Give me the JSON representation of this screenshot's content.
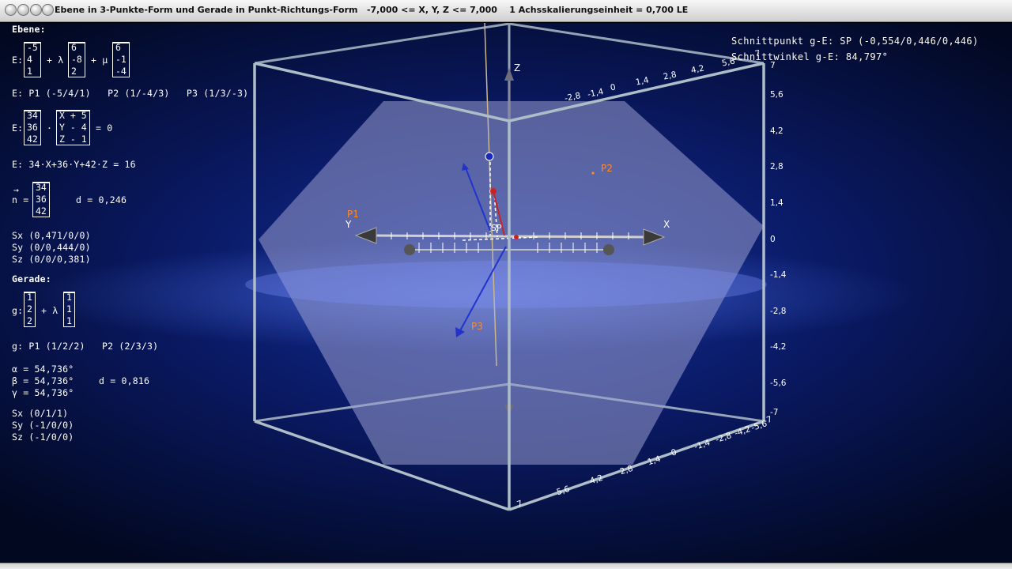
{
  "window": {
    "title": "Ebene in 3-Punkte-Form und Gerade in Punkt-Richtungs-Form   -7,000 <= X, Y, Z <= 7,000    1 Achsskalierungseinheit = 0,700 LE"
  },
  "colors": {
    "background": "#0a1a66",
    "plane": "#8a8fc0",
    "cube_edges": "#b8c8d0",
    "point_labels": "#ff8a2a",
    "line_g": "#b8a878",
    "normal_vector": "#1a2ab8",
    "text": "#ffffff"
  },
  "plane_panel": {
    "heading": "Ebene:",
    "three_point_form": {
      "prefix": "E:",
      "support": [
        "-5",
        "4",
        "1"
      ],
      "lambda": "+ λ",
      "dir1": [
        "6",
        "-8",
        "2"
      ],
      "mu": "+ μ",
      "dir2": [
        "6",
        "-1",
        "-4"
      ]
    },
    "points": "E: P1 (-5/4/1)   P2 (1/-4/3)   P3 (1/3/-3)",
    "normal_form": {
      "prefix": "E:",
      "normal": [
        "34",
        "36",
        "42"
      ],
      "dot": "·",
      "diff": [
        "X + 5",
        "Y - 4",
        "Z - 1"
      ],
      "equals": "= 0"
    },
    "coordinate_form": "E: 34·X+36·Y+42·Z = 16",
    "normal_vector": {
      "arrow": "→",
      "label": "n =",
      "values": [
        "34",
        "36",
        "42"
      ],
      "distance": "d = 0,246"
    },
    "intercepts": [
      "Sx (0,471/0/0)",
      "Sy (0/0,444/0)",
      "Sz (0/0/0,381)"
    ]
  },
  "line_panel": {
    "heading": "Gerade:",
    "form": {
      "prefix": "g:",
      "support": [
        "1",
        "2",
        "2"
      ],
      "lambda": "+ λ",
      "dir": [
        "1",
        "1",
        "1"
      ]
    },
    "points": "g: P1 (1/2/2)   P2 (2/3/3)",
    "angles": [
      "α = 54,736°",
      "β = 54,736°",
      "γ = 54,736°"
    ],
    "distance": "d = 0,816",
    "intercepts": [
      "Sx (0/1/1)",
      "Sy (-1/0/0)",
      "Sz (-1/0/0)"
    ]
  },
  "intersection": {
    "point": "Schnittpunkt g-E: SP (-0,554/0,446/0,446)",
    "angle": "Schnittwinkel g-E: 84,797°"
  },
  "scene": {
    "axis_labels": {
      "x": "X",
      "y": "Y",
      "z": "Z"
    },
    "point_labels": {
      "p1": "P1",
      "p2": "P2",
      "p3": "P3",
      "sp": "SP"
    },
    "right_scale": [
      "7",
      "5,6",
      "4,2",
      "2,8",
      "1,4",
      "0",
      "-1,4",
      "-2,8",
      "-4,2",
      "-5,6",
      "-7"
    ],
    "top_scale": [
      "-2,8",
      "-1,4",
      "0",
      "1,4",
      "2,8",
      "4,2",
      "5,6",
      "7"
    ],
    "bottom_scale": [
      "7",
      "5,6",
      "4,2",
      "2,8",
      "1,4",
      "0",
      "-1,4",
      "-2,8",
      "-4,2",
      "-5,6",
      "-7"
    ]
  }
}
